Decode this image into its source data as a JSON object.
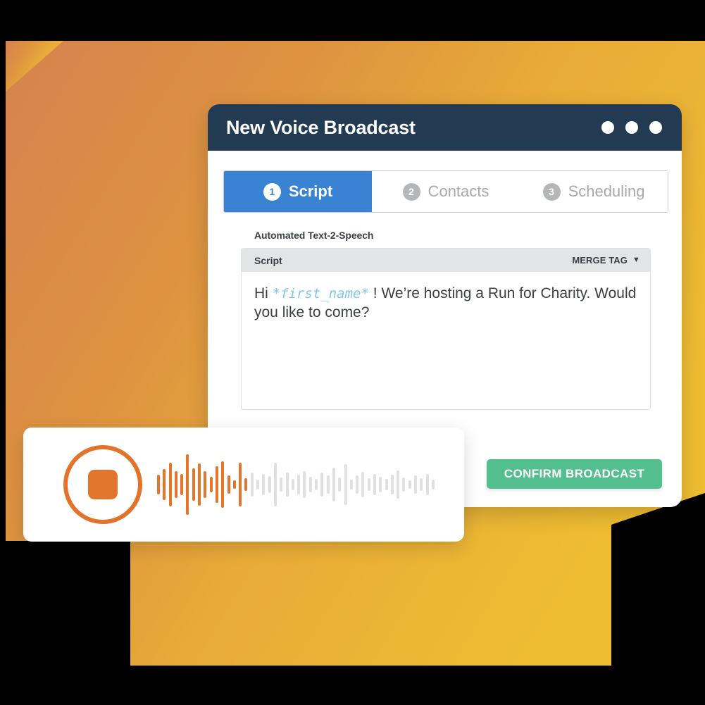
{
  "window": {
    "title": "New Voice Broadcast",
    "titlebar_color": "#223b52",
    "dots": [
      "window-dot-1",
      "window-dot-2",
      "window-dot-3"
    ]
  },
  "tabs": [
    {
      "number": "1",
      "label": "Script",
      "state": "active"
    },
    {
      "number": "2",
      "label": "Contacts",
      "state": "inactive"
    },
    {
      "number": "3",
      "label": "Scheduling",
      "state": "inactive"
    }
  ],
  "script_section": {
    "section_label": "Automated Text-2-Speech",
    "bar_label": "Script",
    "merge_tag_label": "MERGE TAG",
    "merge_tag_caret": "▼",
    "text_before_token": "Hi ",
    "merge_token": "*first_name*",
    "text_after_token": " ! We’re hosting a Run for Charity. Would you like to come?"
  },
  "actions": {
    "confirm_label": "CONFIRM BROADCAST",
    "confirm_color": "#54bf8e"
  },
  "player": {
    "stop_button_name": "stop-recording-button",
    "played_color": "#e2762c",
    "unplayed_color": "#e0e0e0",
    "played_bar_count": 16,
    "waveform_heights": [
      28,
      44,
      62,
      38,
      30,
      86,
      46,
      60,
      38,
      22,
      52,
      66,
      26,
      12,
      62,
      18,
      34,
      14,
      30,
      24,
      62,
      20,
      34,
      16,
      28,
      38,
      22,
      16,
      34,
      26,
      48,
      20,
      58,
      14,
      26,
      36,
      18,
      30,
      22,
      16,
      28,
      40,
      20,
      12,
      26,
      18,
      30,
      14
    ]
  },
  "theme": {
    "orange_top": "#eaa63c",
    "orange_bottom": "#e4a23d",
    "orange_left": "#d9824a",
    "yellow_right": "#eeb934",
    "accent_blue": "#3a83d4",
    "merge_token_color": "#7ec8ef"
  }
}
